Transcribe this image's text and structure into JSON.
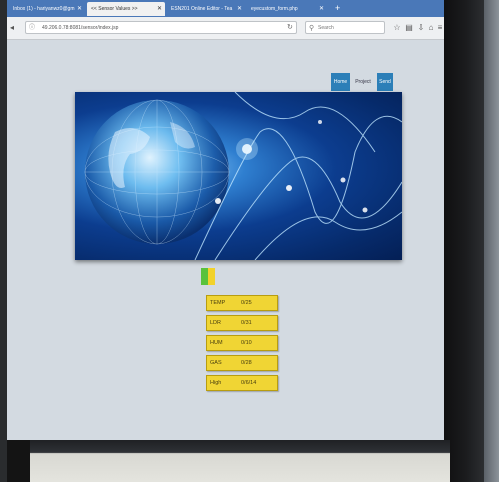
{
  "browser": {
    "tabs": [
      {
        "label": "Inbox (1) - hariyanwz0@gm",
        "active": false
      },
      {
        "label": "<< Sensor Values >>",
        "active": true
      },
      {
        "label": "ESN201 Online Editor - Tea",
        "active": false
      },
      {
        "label": "eyecustom_form.php",
        "active": false
      }
    ],
    "url": "49.206.0.78:8081/sensor/index.jsp",
    "search_placeholder": "Search"
  },
  "page": {
    "nav": {
      "home": "Home",
      "project": "Project",
      "send": "Send"
    },
    "sensors": [
      {
        "label": "TEMP",
        "value": "0/25"
      },
      {
        "label": "LDR",
        "value": "0/31"
      },
      {
        "label": "HUM",
        "value": "0/10"
      },
      {
        "label": "GAS",
        "value": "0/28"
      },
      {
        "label": "High",
        "value": "0/6/14"
      }
    ]
  },
  "colors": {
    "accent": "#2c7fb8",
    "sensor_box": "#f0d534",
    "status_green": "#59c23c",
    "status_yellow": "#f2d22a"
  }
}
